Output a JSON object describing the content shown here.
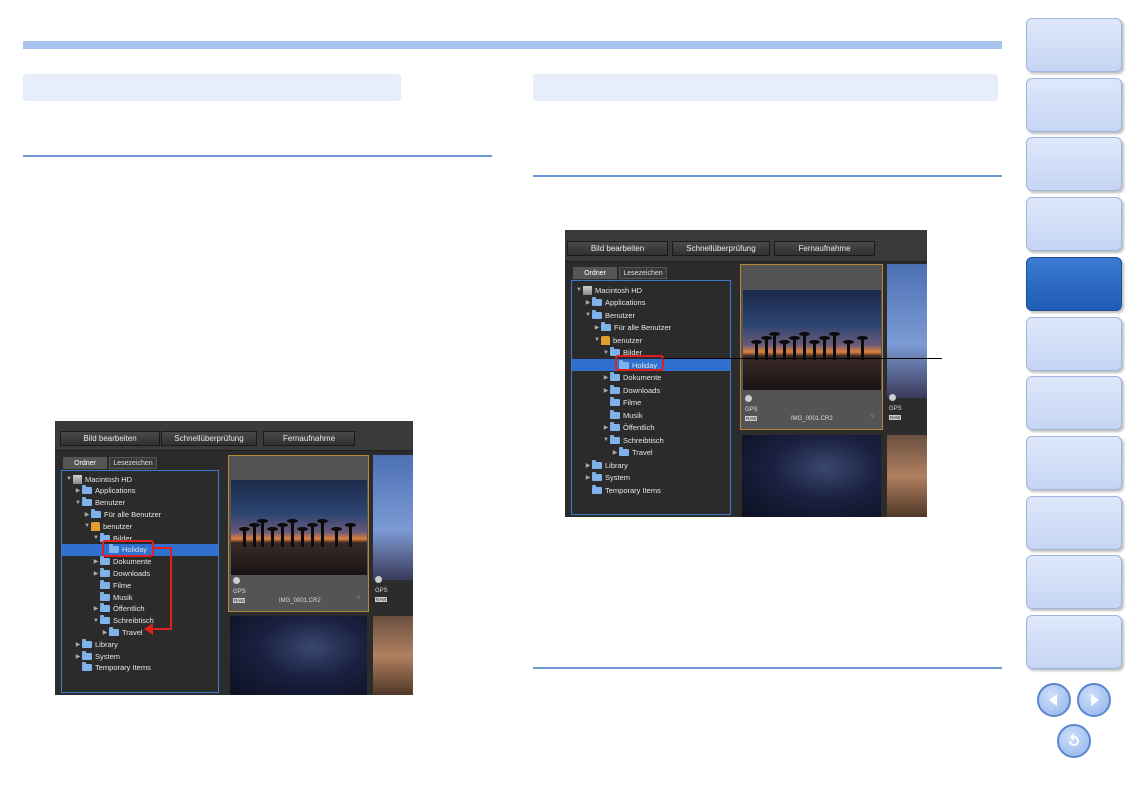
{
  "side_tabs": {
    "count": 11,
    "active_index": 4
  },
  "nav": {
    "prev_icon": "prev-page-icon",
    "next_icon": "next-page-icon",
    "return_icon": "return-icon"
  },
  "screenshot_left": {
    "toolbar": [
      "Bild bearbeiten",
      "Schnellüberprüfung",
      "Fernaufnahme"
    ],
    "tabs": [
      "Ordner",
      "Lesezeichen"
    ],
    "tree": [
      {
        "label": "Macintosh HD",
        "indent": 0,
        "icon": "hd",
        "arrow": "▼"
      },
      {
        "label": "Applications",
        "indent": 1,
        "icon": "folder",
        "arrow": "▶"
      },
      {
        "label": "Benutzer",
        "indent": 1,
        "icon": "folder",
        "arrow": "▼"
      },
      {
        "label": "Für alle Benutzer",
        "indent": 2,
        "icon": "folder",
        "arrow": "▶"
      },
      {
        "label": "benutzer",
        "indent": 2,
        "icon": "user",
        "arrow": "▼"
      },
      {
        "label": "Bilder",
        "indent": 3,
        "icon": "folder",
        "arrow": "▼"
      },
      {
        "label": "Holiday",
        "indent": 4,
        "icon": "folder",
        "arrow": "",
        "selected": true
      },
      {
        "label": "Dokumente",
        "indent": 3,
        "icon": "folder",
        "arrow": "▶"
      },
      {
        "label": "Downloads",
        "indent": 3,
        "icon": "folder",
        "arrow": "▶"
      },
      {
        "label": "Filme",
        "indent": 3,
        "icon": "folder",
        "arrow": ""
      },
      {
        "label": "Musik",
        "indent": 3,
        "icon": "folder",
        "arrow": ""
      },
      {
        "label": "Öffentlich",
        "indent": 3,
        "icon": "folder",
        "arrow": "▶"
      },
      {
        "label": "Schreibtisch",
        "indent": 3,
        "icon": "folder",
        "arrow": "▼"
      },
      {
        "label": "Travel",
        "indent": 4,
        "icon": "folder",
        "arrow": "▶"
      },
      {
        "label": "Library",
        "indent": 1,
        "icon": "folder",
        "arrow": "▶"
      },
      {
        "label": "System",
        "indent": 1,
        "icon": "folder",
        "arrow": "▶"
      },
      {
        "label": "Temporary Items",
        "indent": 1,
        "icon": "folder",
        "arrow": ""
      }
    ],
    "thumb": {
      "gps": "GPS",
      "badge": "RAW",
      "filename": "IMG_0001.CR2"
    },
    "thumb2": {
      "gps": "GPS",
      "badge": "RAW"
    }
  },
  "screenshot_right": {
    "toolbar": [
      "Bild bearbeiten",
      "Schnellüberprüfung",
      "Fernaufnahme"
    ],
    "tabs": [
      "Ordner",
      "Lesezeichen"
    ],
    "tree": [
      {
        "label": "Macintosh HD",
        "indent": 0,
        "icon": "hd",
        "arrow": "▼"
      },
      {
        "label": "Applications",
        "indent": 1,
        "icon": "folder",
        "arrow": "▶"
      },
      {
        "label": "Benutzer",
        "indent": 1,
        "icon": "folder",
        "arrow": "▼"
      },
      {
        "label": "Für alle Benutzer",
        "indent": 2,
        "icon": "folder",
        "arrow": "▶"
      },
      {
        "label": "benutzer",
        "indent": 2,
        "icon": "user",
        "arrow": "▼"
      },
      {
        "label": "Bilder",
        "indent": 3,
        "icon": "folder",
        "arrow": "▼"
      },
      {
        "label": "Holiday",
        "indent": 4,
        "icon": "folder",
        "arrow": "",
        "selected": true
      },
      {
        "label": "Dokumente",
        "indent": 3,
        "icon": "folder",
        "arrow": "▶"
      },
      {
        "label": "Downloads",
        "indent": 3,
        "icon": "folder",
        "arrow": "▶"
      },
      {
        "label": "Filme",
        "indent": 3,
        "icon": "folder",
        "arrow": ""
      },
      {
        "label": "Musik",
        "indent": 3,
        "icon": "folder",
        "arrow": ""
      },
      {
        "label": "Öffentlich",
        "indent": 3,
        "icon": "folder",
        "arrow": "▶"
      },
      {
        "label": "Schreibtisch",
        "indent": 3,
        "icon": "folder",
        "arrow": "▼"
      },
      {
        "label": "Travel",
        "indent": 4,
        "icon": "folder",
        "arrow": "▶"
      },
      {
        "label": "Library",
        "indent": 1,
        "icon": "folder",
        "arrow": "▶"
      },
      {
        "label": "System",
        "indent": 1,
        "icon": "folder",
        "arrow": "▶"
      },
      {
        "label": "Temporary Items",
        "indent": 1,
        "icon": "folder",
        "arrow": ""
      }
    ],
    "thumb": {
      "gps": "GPS",
      "badge": "RAW",
      "filename": "IMG_0001.CR2"
    },
    "thumb2": {
      "gps": "GPS",
      "badge": "RAW"
    }
  },
  "colors": {
    "accent": "#6f9ad6",
    "heading_bg": "#e7eef9",
    "tab_active": "#2a67c2",
    "highlight": "#e02020"
  }
}
